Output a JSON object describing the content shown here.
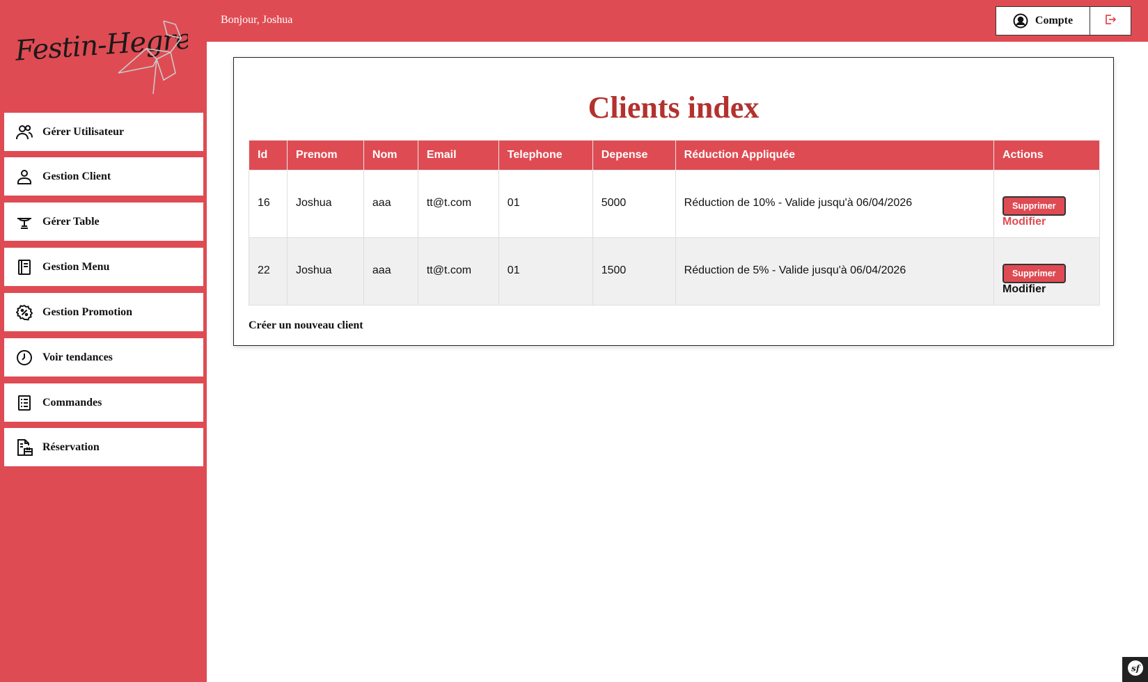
{
  "brand": {
    "logo_text": "Festin-Hegre"
  },
  "header": {
    "greeting": "Bonjour, Joshua",
    "account_label": "Compte"
  },
  "sidebar": {
    "items": [
      {
        "label": "Gérer Utilisateur",
        "icon": "users-icon"
      },
      {
        "label": "Gestion Client",
        "icon": "user-icon"
      },
      {
        "label": "Gérer Table",
        "icon": "table-icon"
      },
      {
        "label": "Gestion Menu",
        "icon": "menu-book-icon"
      },
      {
        "label": "Gestion Promotion",
        "icon": "promotion-icon"
      },
      {
        "label": "Voir tendances",
        "icon": "clock-icon"
      },
      {
        "label": "Commandes",
        "icon": "list-icon"
      },
      {
        "label": "Réservation",
        "icon": "reservation-icon"
      }
    ]
  },
  "main": {
    "title": "Clients index",
    "columns": [
      "Id",
      "Prenom",
      "Nom",
      "Email",
      "Telephone",
      "Depense",
      "Réduction Appliquée",
      "Actions"
    ],
    "rows": [
      {
        "id": "16",
        "prenom": "Joshua",
        "nom": "aaa",
        "email": "tt@t.com",
        "telephone": "01",
        "depense": "5000",
        "reduction": "Réduction de 10% - Valide jusqu'à 06/04/2026",
        "delete_label": "Supprimer",
        "edit_label": "Modifier"
      },
      {
        "id": "22",
        "prenom": "Joshua",
        "nom": "aaa",
        "email": "tt@t.com",
        "telephone": "01",
        "depense": "1500",
        "reduction": "Réduction de 5% - Valide jusqu'à 06/04/2026",
        "delete_label": "Supprimer",
        "edit_label": "Modifier"
      }
    ],
    "create_link": "Créer un nouveau client"
  },
  "colors": {
    "brand_red": "#df4b53",
    "title_red": "#b3322e",
    "alt_row": "#f0f0f0"
  },
  "toolbar": {
    "badge_text": "sf"
  }
}
